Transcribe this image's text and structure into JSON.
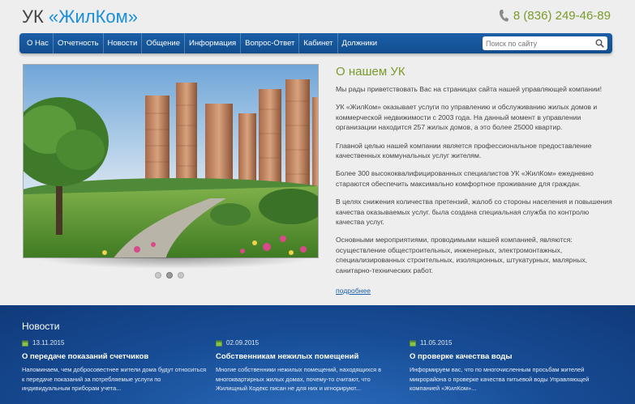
{
  "header": {
    "logo_prefix": "УК ",
    "logo_brand": "«ЖилКом»",
    "phone": "8 (836) 249-46-89"
  },
  "nav": {
    "items": [
      "О Нас",
      "Отчетность",
      "Новости",
      "Общение",
      "Информация",
      "Вопрос-Ответ",
      "Кабинет",
      "Должники"
    ],
    "search_placeholder": "Поиск по сайту"
  },
  "slider": {
    "slide_count": 3,
    "active_index": 1
  },
  "about": {
    "title": "О нашем УК",
    "paragraphs": [
      "Мы рады приветствовать Вас на страницах сайта нашей управляющей компании!",
      "УК «ЖилКом» оказывает услуги по управлению и обслуживанию жилых домов и коммерческой недвижимости с 2003 года. На данный момент в управлении организации находится 257 жилых домов, а это более 25000 квартир.",
      "Главной целью нашей компании является профессиональное предоставление качественных коммунальных услуг жителям.",
      "Более 300 высококвалифицированных специалистов УК «ЖилКом» ежедневно стараются обеспечить максимально комфортное проживание для граждан.",
      "В целях снижения количества претензий, жалоб со стороны населения и повышения качества оказываемых услуг. была создана специальная служба по контролю качества услуг.",
      "Основными мероприятиями, проводимыми нашей компанией, являются: осуществление общестроительных, инженерных, электромонтажных, специализированных строительных, изоляционных, штукатурных, малярных, санитарно-технических работ."
    ],
    "more_link": "подробнее"
  },
  "news": {
    "heading": "Новости",
    "items": [
      {
        "date": "13.11.2015",
        "title": "О передаче показаний счетчиков",
        "text": "Напоминаем, чем добросовестнее жители дома будут относиться к передаче показаний за потребляемые услуги по индивидуальным приборам учета..."
      },
      {
        "date": "02.09.2015",
        "title": "Собственникам нежилых помещений",
        "text": "Многие собственники нежилых помещений, находящихся в многоквартирных жилых домах, почему-то считают, что Жилищный Кодекс писан не для них и игнорируют..."
      },
      {
        "date": "11.05.2015",
        "title": "О проверке качества воды",
        "text": "Информируем вас, что по многочисленным просьбам жителей микрорайона о проверке качества питьевой воды Управляющей компанией «ЖилКом»..."
      }
    ]
  },
  "colors": {
    "brand_blue": "#1a8fd8",
    "accent_green": "#7a9c2a",
    "nav_blue": "#1b5fa8",
    "news_blue": "#174c95"
  }
}
